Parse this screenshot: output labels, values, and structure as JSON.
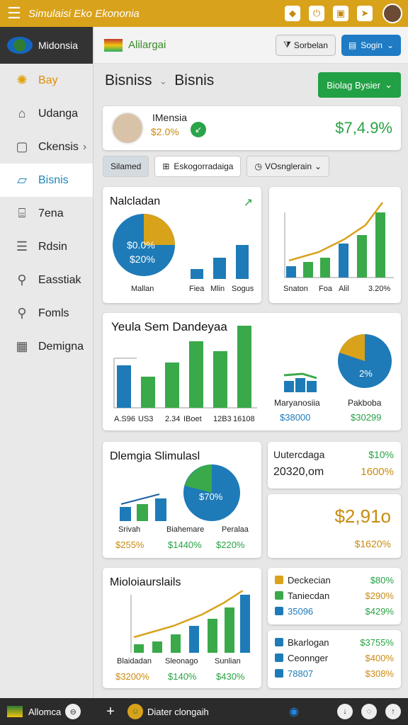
{
  "topbar": {
    "title": "Simulaisi Eko Ekononia"
  },
  "sidebar": {
    "brand": "Midonsia",
    "items": [
      {
        "label": "Bay",
        "icon": "sun-icon"
      },
      {
        "label": "Udanga",
        "icon": "tag-icon"
      },
      {
        "label": "Ckensis",
        "icon": "device-icon"
      },
      {
        "label": "Bisnis",
        "icon": "chart-icon"
      },
      {
        "label": "7ena",
        "icon": "building-icon"
      },
      {
        "label": "Rdsin",
        "icon": "list-icon"
      },
      {
        "label": "Easstiak",
        "icon": "search-icon"
      },
      {
        "label": "Fomls",
        "icon": "magnifier-icon"
      },
      {
        "label": "Demigna",
        "icon": "grid-icon"
      }
    ]
  },
  "header": {
    "app": "Alilargai",
    "search_btn": "Sorbelan",
    "login_btn": "Sogin"
  },
  "breadcrumb": {
    "first": "Bisniss",
    "second": "Bisnis"
  },
  "action_btn": "Biolag Bysier",
  "profile": {
    "name": "IMensia",
    "pct": "$2.0%",
    "value": "$7,4.9%"
  },
  "tabs": [
    "Silamed",
    "Eskogorradaiga",
    "VOsnglerain"
  ],
  "card1": {
    "title": "Nalcladan",
    "pie_a": "$0.0%",
    "pie_b": "$20%",
    "labels": [
      "Mallan",
      "Fiea",
      "Mlin",
      "Sogus"
    ]
  },
  "card2": {
    "labels": [
      "Snaton",
      "Foa",
      "Alil",
      "3.20%"
    ]
  },
  "card3": {
    "title": "Yeula Sem Dandeyaa",
    "axis": [
      "A.S96",
      "US3",
      "2.34",
      "IBoet",
      "12B3",
      "16108"
    ],
    "mid_label": "Maryanosiia",
    "mid_val": "$38000",
    "pie_label": "Pakboba",
    "pie_val": "$30299",
    "pie_pct": "2%"
  },
  "card4": {
    "title": "Dlemgia Slimulasl",
    "pie_pct": "$70%",
    "labels": [
      "Srivah",
      "Biahemare",
      "Peralaa"
    ],
    "vals": [
      "$255%",
      "$1440%",
      "$220%"
    ]
  },
  "card5": {
    "title": "Uutercdaga",
    "sub": "20320,om",
    "v1": "$10%",
    "v2": "1600%"
  },
  "card6": {
    "big": "$2,91o",
    "sub": "$1620%"
  },
  "card7": {
    "title": "Mioloiaurslails",
    "labels": [
      "Blaidadan",
      "Sleonago",
      "Sunlian"
    ],
    "vals": [
      "$3200%",
      "$140%",
      "$430%"
    ]
  },
  "card8": {
    "rows": [
      {
        "l": "Deckecian",
        "v": "$80%"
      },
      {
        "l": "Taniecdan",
        "v": "$290%"
      },
      {
        "l": "35096",
        "v": "$429%"
      }
    ]
  },
  "card9": {
    "rows": [
      {
        "l": "Bkarlogan",
        "v": "$3755%"
      },
      {
        "l": "Ceonnger",
        "v": "$400%"
      },
      {
        "l": "78807",
        "v": "$308%"
      }
    ]
  },
  "bottombar": {
    "app": "Allomca",
    "center": "Diater clongaih"
  }
}
